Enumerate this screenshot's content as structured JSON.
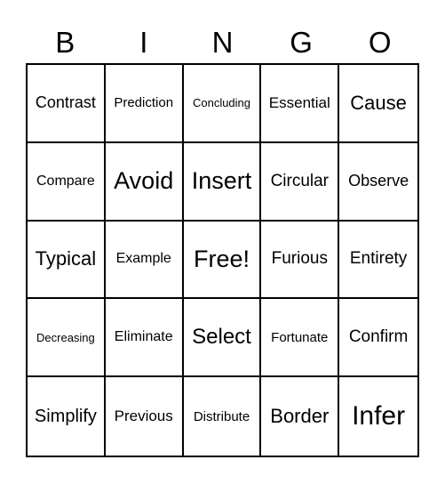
{
  "header": {
    "letters": [
      "B",
      "I",
      "N",
      "G",
      "O"
    ]
  },
  "cells": [
    [
      "Contrast",
      "Prediction",
      "Concluding",
      "Essential",
      "Cause"
    ],
    [
      "Compare",
      "Avoid",
      "Insert",
      "Circular",
      "Observe"
    ],
    [
      "Typical",
      "Example",
      "Free!",
      "Furious",
      "Entirety"
    ],
    [
      "Decreasing",
      "Eliminate",
      "Select",
      "Fortunate",
      "Confirm"
    ],
    [
      "Simplify",
      "Previous",
      "Distribute",
      "Border",
      "Infer"
    ]
  ]
}
